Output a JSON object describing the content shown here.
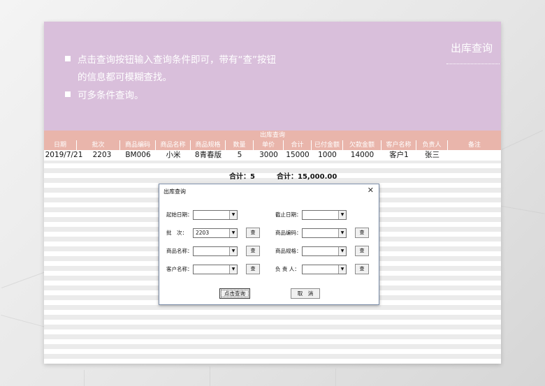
{
  "banner": {
    "bullet1_line1": "点击查询按钮输入查询条件即可，带有“查”按钮",
    "bullet1_line2": "的信息都可模糊查找。",
    "bullet2": "可多条件查询。",
    "title": "出库查询"
  },
  "table": {
    "title": "出库查询",
    "headers": [
      "日期",
      "批次",
      "商品编码",
      "商品名称",
      "商品规格",
      "数量",
      "单价",
      "合计",
      "已付金额",
      "欠款金额",
      "客户名称",
      "负责人",
      "备注"
    ],
    "rows": [
      [
        "2019/7/21",
        "2203",
        "BM006",
        "小米",
        "8青春版",
        "5",
        "3000",
        "15000",
        "1000",
        "14000",
        "客户1",
        "张三",
        ""
      ]
    ],
    "totals": {
      "qty": "合计：5",
      "amount": "合计：15,000.00"
    }
  },
  "dialog": {
    "title": "出库查询",
    "close": "✕",
    "fields": {
      "start_date": {
        "label": "起始日期：",
        "value": ""
      },
      "end_date": {
        "label": "截止日期：",
        "value": ""
      },
      "batch": {
        "label": "批　次：",
        "value": "2203"
      },
      "product_code": {
        "label": "商品编码：",
        "value": ""
      },
      "product_name": {
        "label": "商品名称：",
        "value": ""
      },
      "product_spec": {
        "label": "商品规格：",
        "value": ""
      },
      "customer": {
        "label": "客户名称：",
        "value": ""
      },
      "owner": {
        "label": "负 责 人：",
        "value": ""
      }
    },
    "query_glyph": "查",
    "dropdown_glyph": "▼",
    "submit_label": "点击查询",
    "cancel_label": "取　消"
  },
  "colors": {
    "banner": "#d9bfdb",
    "table_header": "#e9b5ab",
    "dialog_border": "#7a8ca8"
  }
}
